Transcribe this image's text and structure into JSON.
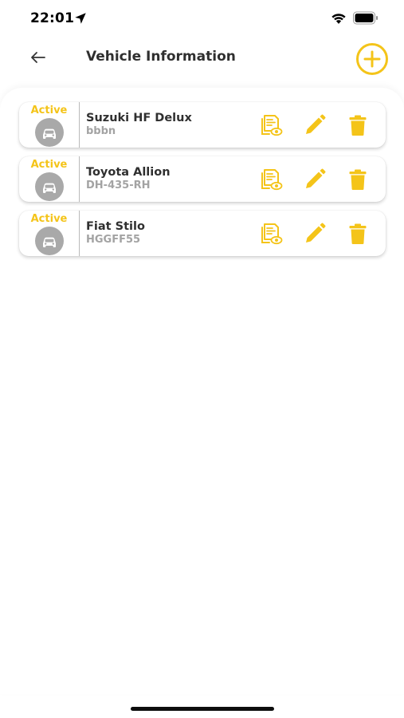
{
  "status_bar": {
    "time": "22:01"
  },
  "header": {
    "title": "Vehicle Information",
    "back_icon": "arrow-left-icon",
    "add_icon": "plus-circle-icon"
  },
  "colors": {
    "accent": "#F4C419",
    "avatar_bg": "#A9A9A9",
    "text_primary": "#2F2F2F",
    "text_secondary": "#A3A3A3"
  },
  "vehicles": [
    {
      "status": "Active",
      "name": "Suzuki HF Delux",
      "plate": "bbbn"
    },
    {
      "status": "Active",
      "name": "Toyota Allion",
      "plate": "DH-435-RH"
    },
    {
      "status": "Active",
      "name": "Fiat Stilo",
      "plate": "HGGFF55"
    }
  ],
  "actions": {
    "view_icon": "document-view-icon",
    "edit_icon": "pencil-icon",
    "delete_icon": "trash-icon"
  }
}
